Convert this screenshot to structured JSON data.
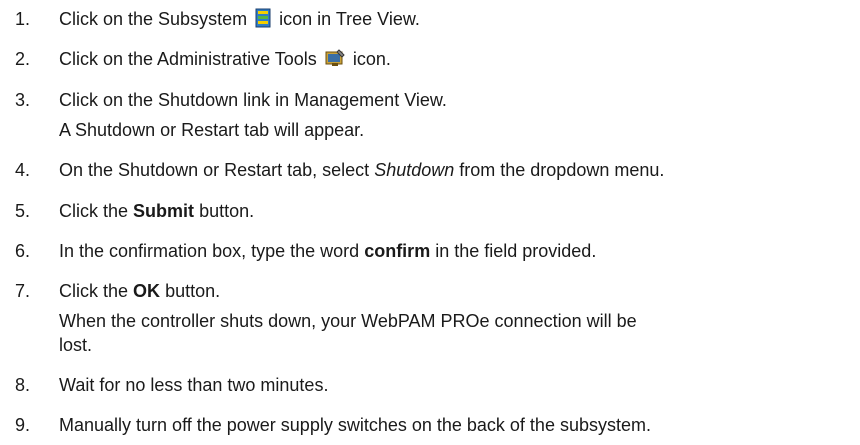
{
  "steps": [
    {
      "number": "1.",
      "before": "Click on the Subsystem",
      "icon": "subsystem-icon",
      "after": "icon in Tree View."
    },
    {
      "number": "2.",
      "before": "Click on the Administrative Tools",
      "icon": "administrative-tools-icon",
      "after": "icon."
    },
    {
      "number": "3.",
      "text": "Click on the Shutdown link in Management View.",
      "note": "A Shutdown or Restart tab will appear."
    },
    {
      "number": "4.",
      "before": "On the Shutdown or Restart tab, select",
      "emphasis": "Shutdown",
      "after": "from the dropdown menu."
    },
    {
      "number": "5.",
      "before": "Click the",
      "bold": "Submit",
      "after": "button."
    },
    {
      "number": "6.",
      "before": "In the confirmation box, type the word",
      "bold": "confirm",
      "after": "in the field provided."
    },
    {
      "number": "7.",
      "before": "Click the",
      "bold": "OK",
      "after": "button.",
      "note_line1": "When the controller shuts down, your WebPAM PROe connection will be",
      "note_line2": "lost."
    },
    {
      "number": "8.",
      "text": "Wait for no less than two minutes."
    },
    {
      "number": "9.",
      "text": "Manually turn off the power supply switches on the back of the subsystem."
    }
  ]
}
